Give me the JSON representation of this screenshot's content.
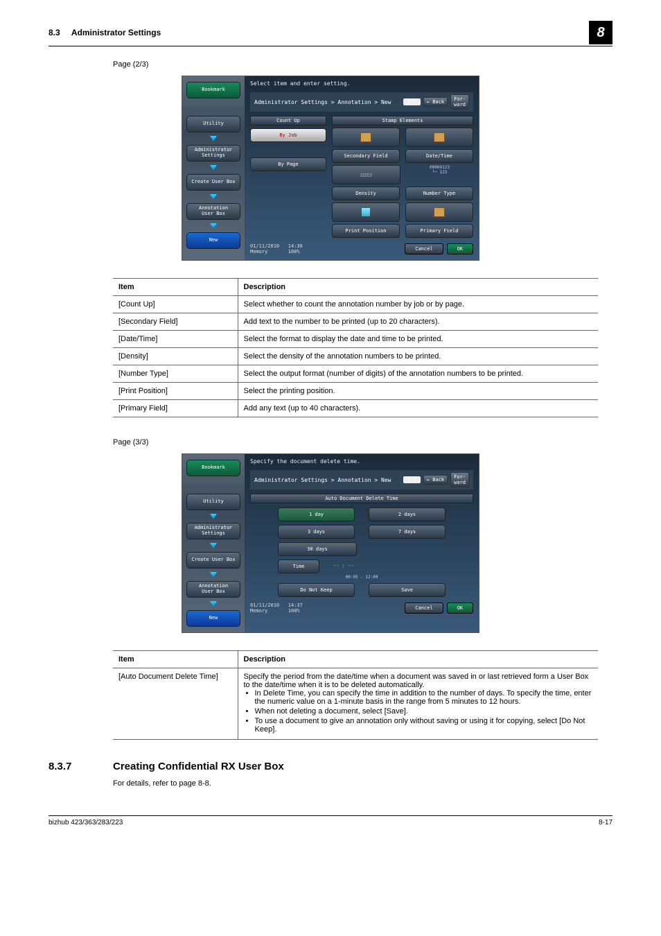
{
  "header": {
    "section": "8.3",
    "title": "Administrator Settings",
    "chapter": "8"
  },
  "page_labels": {
    "p23": "Page (2/3)",
    "p33": "Page (3/3)"
  },
  "screenshot1": {
    "hint": "Select item and enter setting.",
    "breadcrumb": "Administrator Settings > Annotation > New",
    "page": "2/3",
    "back": "Back",
    "forward": "For-\nward",
    "sidebar": {
      "bookmark": "Bookmark",
      "utility": "Utility",
      "admin": "Administrator\nSettings",
      "create": "Create User Box",
      "anno": "Annotation\nUser Box",
      "new": "New"
    },
    "countup_title": "Count Up",
    "byjob": "By Job",
    "bypage": "By Page",
    "stamp_title": "Stamp Elements",
    "secondary": "Secondary Field",
    "datetime": "Date/Time",
    "density": "Density",
    "numbertype": "Number Type",
    "printpos": "Print Position",
    "primary": "Primary Field",
    "sample_num": "00000123",
    "timestamp": "01/11/2010   14:36\nMemory       100%",
    "cancel": "Cancel",
    "ok": "OK"
  },
  "table1": {
    "hItem": "Item",
    "hDesc": "Description",
    "rows": [
      {
        "item": "[Count Up]",
        "desc": "Select whether to count the annotation number by job or by page."
      },
      {
        "item": "[Secondary Field]",
        "desc": "Add text to the number to be printed (up to 20 characters)."
      },
      {
        "item": "[Date/Time]",
        "desc": "Select the format to display the date and time to be printed."
      },
      {
        "item": "[Density]",
        "desc": "Select the density of the annotation numbers to be printed."
      },
      {
        "item": "[Number Type]",
        "desc": "Select the output format (number of digits) of the annotation numbers to be printed."
      },
      {
        "item": "[Print Position]",
        "desc": "Select the printing position."
      },
      {
        "item": "[Primary Field]",
        "desc": "Add any text (up to 40 characters)."
      }
    ]
  },
  "screenshot2": {
    "hint": "Specify the document delete time.",
    "breadcrumb": "Administrator Settings > Annotation > New",
    "page": "3/3",
    "section_title": "Auto Document Delete Time",
    "d1": "1 day",
    "d2": "2 days",
    "d3": "3 days",
    "d7": "7 days",
    "d30": "30 days",
    "time": "Time",
    "time_val": "-- : --",
    "time_range": "00:05 - 12:00",
    "donotkeep": "Do Not Keep",
    "save": "Save",
    "timestamp": "01/11/2010   14:37\nMemory       100%"
  },
  "table2": {
    "hItem": "Item",
    "hDesc": "Description",
    "row": {
      "item": "[Auto Document Delete Time]",
      "intro": "Specify the period from the date/time when a document was saved in or last retrieved form a User Box to the date/time when it is to be deleted automatically.",
      "b1": "In Delete Time, you can specify the time in addition to the number of days. To specify the time, enter the numeric value on a 1-minute basis in the range from 5 minutes to 12 hours.",
      "b2": "When not deleting a document, select [Save].",
      "b3": "To use a document to give an annotation only without saving or using it for copying, select [Do Not Keep]."
    }
  },
  "h2": {
    "num": "8.3.7",
    "title": "Creating Confidential RX User Box"
  },
  "body": {
    "refer": "For details, refer to page 8-8."
  },
  "footer": {
    "model": "bizhub 423/363/283/223",
    "page": "8-17"
  }
}
